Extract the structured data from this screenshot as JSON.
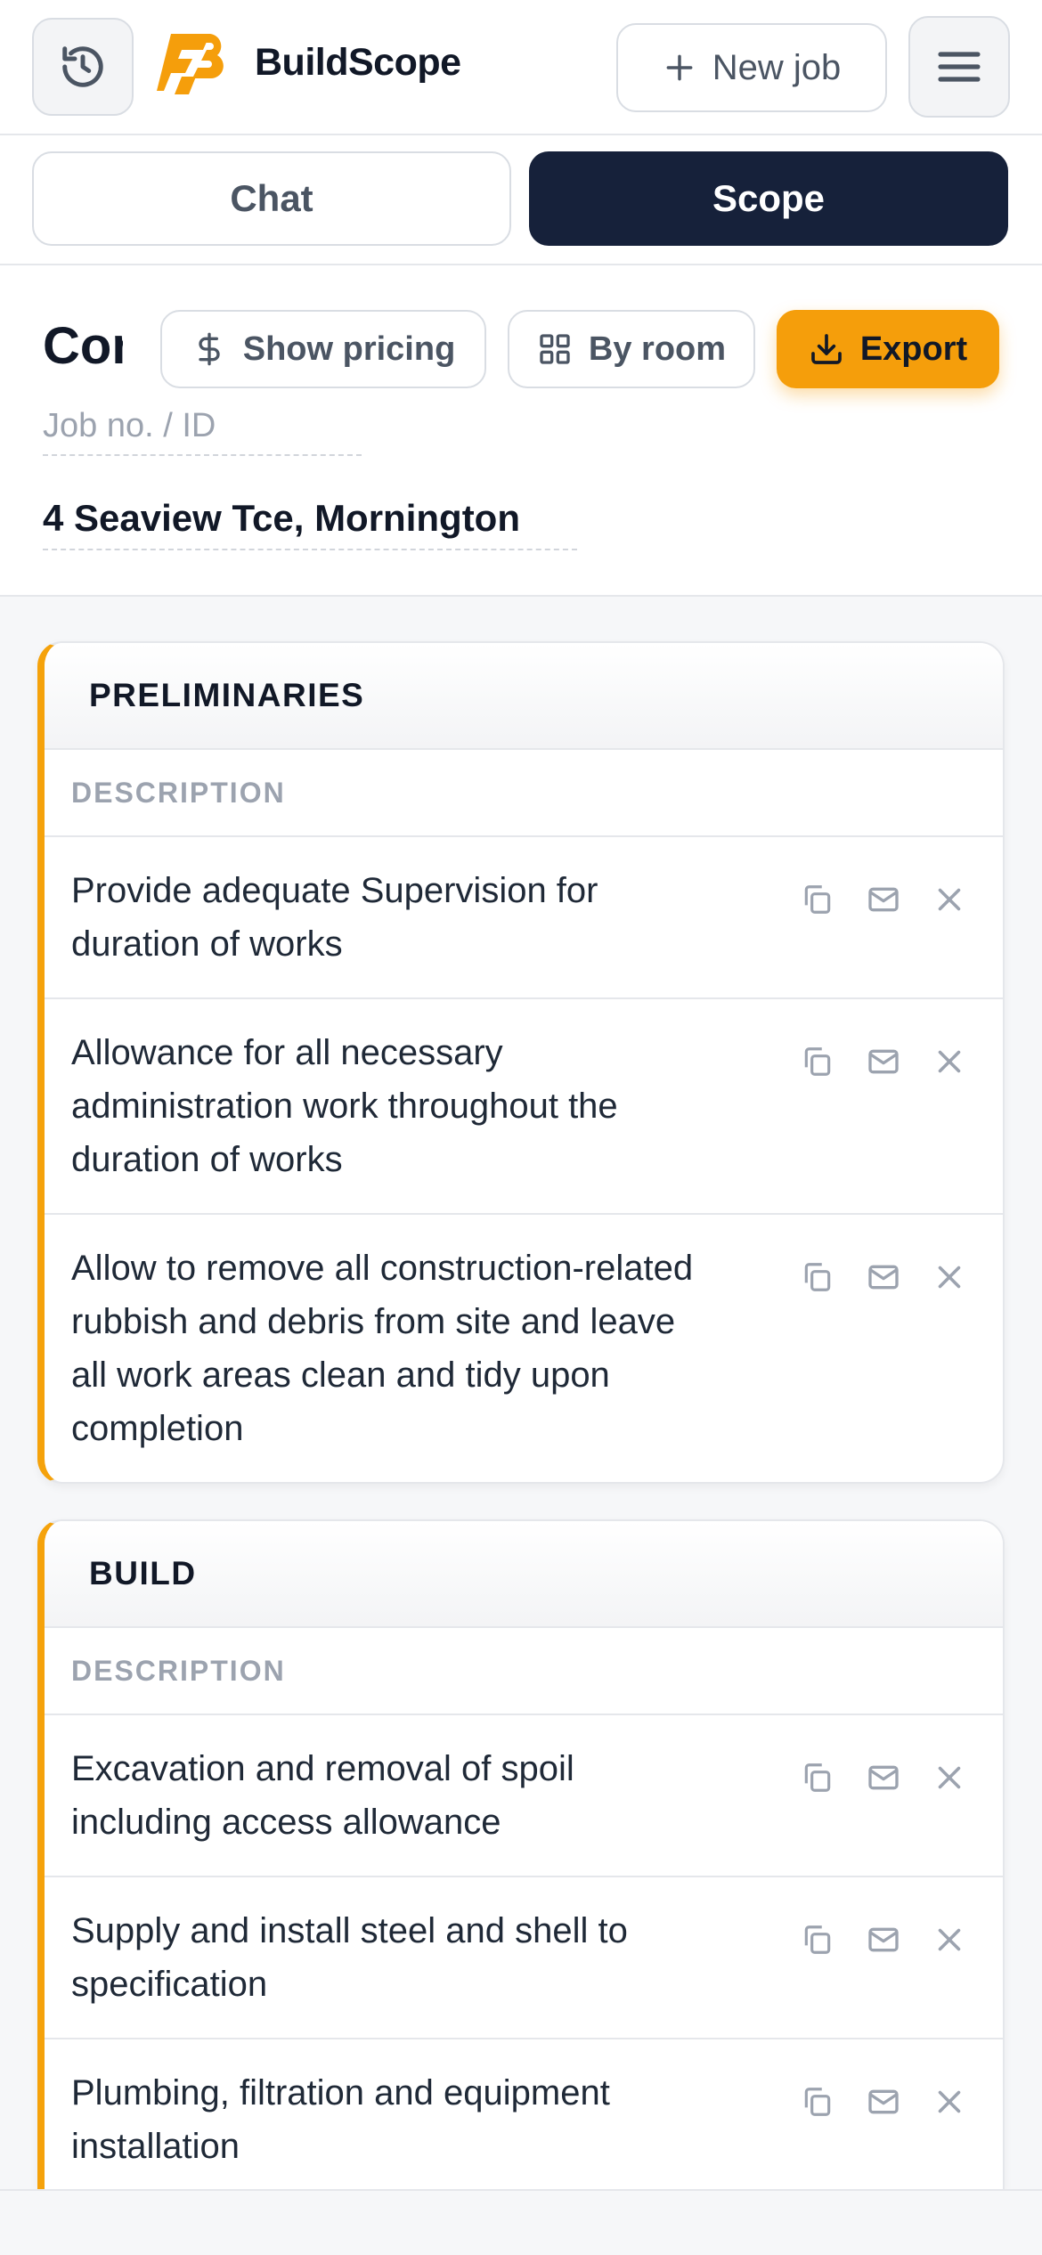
{
  "header": {
    "brand": "BuildScope",
    "new_job_label": "New job",
    "icons": {
      "history": "history-icon",
      "logo": "buildscope-logo",
      "plus": "plus-icon",
      "menu": "hamburger-menu-icon"
    }
  },
  "tabs": [
    {
      "label": "Chat",
      "active": false
    },
    {
      "label": "Scope",
      "active": true
    }
  ],
  "toolbar": {
    "doc_title": "Con",
    "show_pricing_label": "Show pricing",
    "by_room_label": "By room",
    "export_label": "Export"
  },
  "job": {
    "job_no_placeholder": "Job no. / ID",
    "address": "4 Seaview Tce, Mornington"
  },
  "sections": [
    {
      "title": "PRELIMINARIES",
      "column": "DESCRIPTION",
      "items": [
        "Provide adequate Supervision for duration of works",
        "Allowance for all necessary administration work throughout the duration of works",
        "Allow to remove all construction-related rubbish and debris from site and leave all work areas clean and tidy upon completion"
      ]
    },
    {
      "title": "BUILD",
      "column": "DESCRIPTION",
      "items": [
        "Excavation and removal of spoil including access allowance",
        "Supply and install steel and shell to specification",
        "Plumbing, filtration and equipment installation"
      ]
    }
  ],
  "row_action_icons": [
    "copy-icon",
    "mail-icon",
    "close-icon"
  ],
  "colors": {
    "accent": "#f59e0b",
    "dark": "#16213a"
  }
}
